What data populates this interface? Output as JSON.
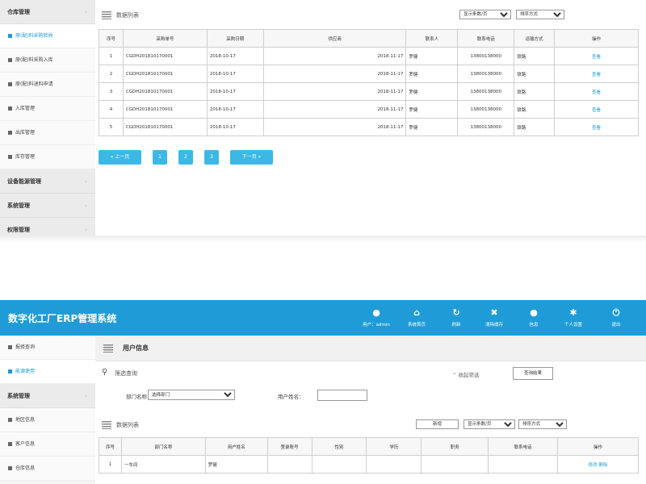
{
  "shot1": {
    "sidebar": {
      "groups_top": [
        {
          "label": "仓库管理"
        }
      ],
      "items": [
        {
          "label": "原(配)料采购验收",
          "active": true
        },
        {
          "label": "原(配)料采购入库",
          "active": false
        },
        {
          "label": "原(配)料退料申请",
          "active": false
        },
        {
          "label": "入库管理",
          "active": false
        },
        {
          "label": "出库管理",
          "active": false
        },
        {
          "label": "库存管理",
          "active": false
        }
      ],
      "groups_bottom": [
        {
          "label": "设备能源管理"
        },
        {
          "label": "系统管理"
        },
        {
          "label": "权限管理"
        }
      ],
      "chevron": "›"
    },
    "panel_title": "数据列表",
    "display_select": "显示条数/页",
    "sort_select": "排序方式",
    "table": {
      "headers": [
        "序号",
        "采购单号",
        "采购日期",
        "供应商",
        "联系人",
        "联系电话",
        "运输方式",
        "操作"
      ],
      "rows": [
        [
          "1",
          "CGDH201810170001",
          "2018-10-17",
          "2018-11-17",
          "罗健",
          "13800138000",
          "铁路",
          "查看"
        ],
        [
          "2",
          "CGDH201810170001",
          "2018-10-17",
          "2018-11-17",
          "罗健",
          "13800138000",
          "铁路",
          "查看"
        ],
        [
          "3",
          "CGDH201810170001",
          "2018-10-17",
          "2018-11-17",
          "罗健",
          "13800138000",
          "铁路",
          "查看"
        ],
        [
          "4",
          "CGDH201810170001",
          "2018-10-17",
          "2018-11-17",
          "罗健",
          "13800138000",
          "铁路",
          "查看"
        ],
        [
          "5",
          "CGDH201810170001",
          "2018-10-17",
          "2018-11-17",
          "罗健",
          "13800138000",
          "铁路",
          "查看"
        ]
      ]
    },
    "pagination": {
      "prev": "« 上一页",
      "pages": [
        "1",
        "2",
        "3"
      ],
      "next": "下一页 »"
    }
  },
  "shot2": {
    "app_title": "数字化工厂ERP管理系统",
    "toolbar": [
      {
        "icon": "user-icon",
        "glyph": "●",
        "label": "用户：admin"
      },
      {
        "icon": "home-icon",
        "glyph": "⌂",
        "label": "系统首页"
      },
      {
        "icon": "refresh-icon",
        "glyph": "↻",
        "label": "刷新"
      },
      {
        "icon": "clear-cache-icon",
        "glyph": "✖",
        "label": "清除缓存"
      },
      {
        "icon": "message-icon",
        "glyph": "●",
        "label": "信息"
      },
      {
        "icon": "gear-icon",
        "glyph": "✱",
        "label": "个人设置"
      },
      {
        "icon": "power-icon",
        "glyph": "⏻",
        "label": "退出"
      }
    ],
    "sidebar": {
      "items_top": [
        {
          "label": "报修查询",
          "active": false
        },
        {
          "label": "能源使用",
          "active": true
        }
      ],
      "group": {
        "label": "系统管理"
      },
      "items_bottom": [
        {
          "label": "地区信息",
          "active": false
        },
        {
          "label": "客户信息",
          "active": false
        },
        {
          "label": "仓库信息",
          "active": false
        }
      ],
      "chevron": "›"
    },
    "page_title": "用户信息",
    "filter": {
      "title": "筛选查询",
      "collapse_label": "收起筛选",
      "query_button": "查询结果",
      "dept_label": "部门名称：",
      "dept_select": "选择部门",
      "name_label": "用户姓名：",
      "name_value": ""
    },
    "list": {
      "title": "数据列表",
      "add_button": "新增",
      "display_select": "显示条数/页",
      "sort_select": "排序方式"
    },
    "table": {
      "headers": [
        "序号",
        "部门名称",
        "用户姓名",
        "登录账号",
        "性别",
        "学历",
        "职务",
        "联系电话",
        "操作"
      ],
      "rows": [
        {
          "no": "1",
          "dept": "一车间",
          "name": "罗健",
          "edit": "修改",
          "delete": "删除"
        }
      ]
    },
    "colors": {
      "accent": "#1f9cd8",
      "link": "#1c9ad6",
      "pager": "#3cb8e5"
    }
  }
}
